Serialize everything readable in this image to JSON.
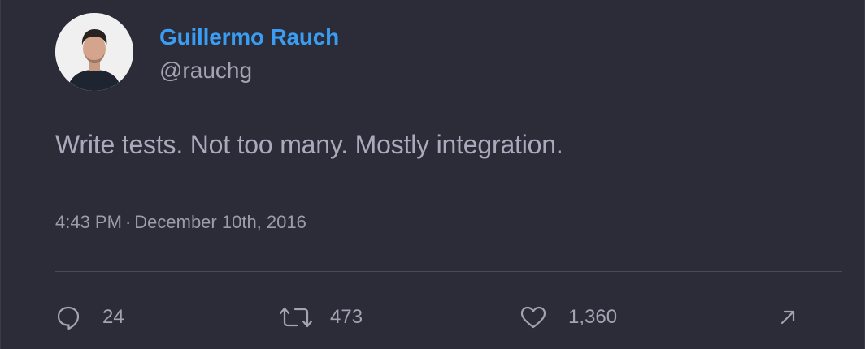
{
  "tweet": {
    "author": {
      "display_name": "Guillermo Rauch",
      "handle": "@rauchg",
      "avatar_icon": "profile-photo"
    },
    "text": "Write tests. Not too many. Mostly integration.",
    "time": "4:43 PM",
    "separator": "·",
    "date": "December 10th, 2016"
  },
  "actions": {
    "reply": {
      "icon": "speech-bubble-icon",
      "count": "24"
    },
    "retweet": {
      "icon": "retweet-arrows-icon",
      "count": "473"
    },
    "like": {
      "icon": "heart-icon",
      "count": "1,360"
    },
    "share": {
      "icon": "diagonal-arrow-icon"
    }
  },
  "colors": {
    "background": "#2b2c37",
    "name": "#3a9df2",
    "text": "#a9aabb",
    "muted": "#9c9dab"
  }
}
